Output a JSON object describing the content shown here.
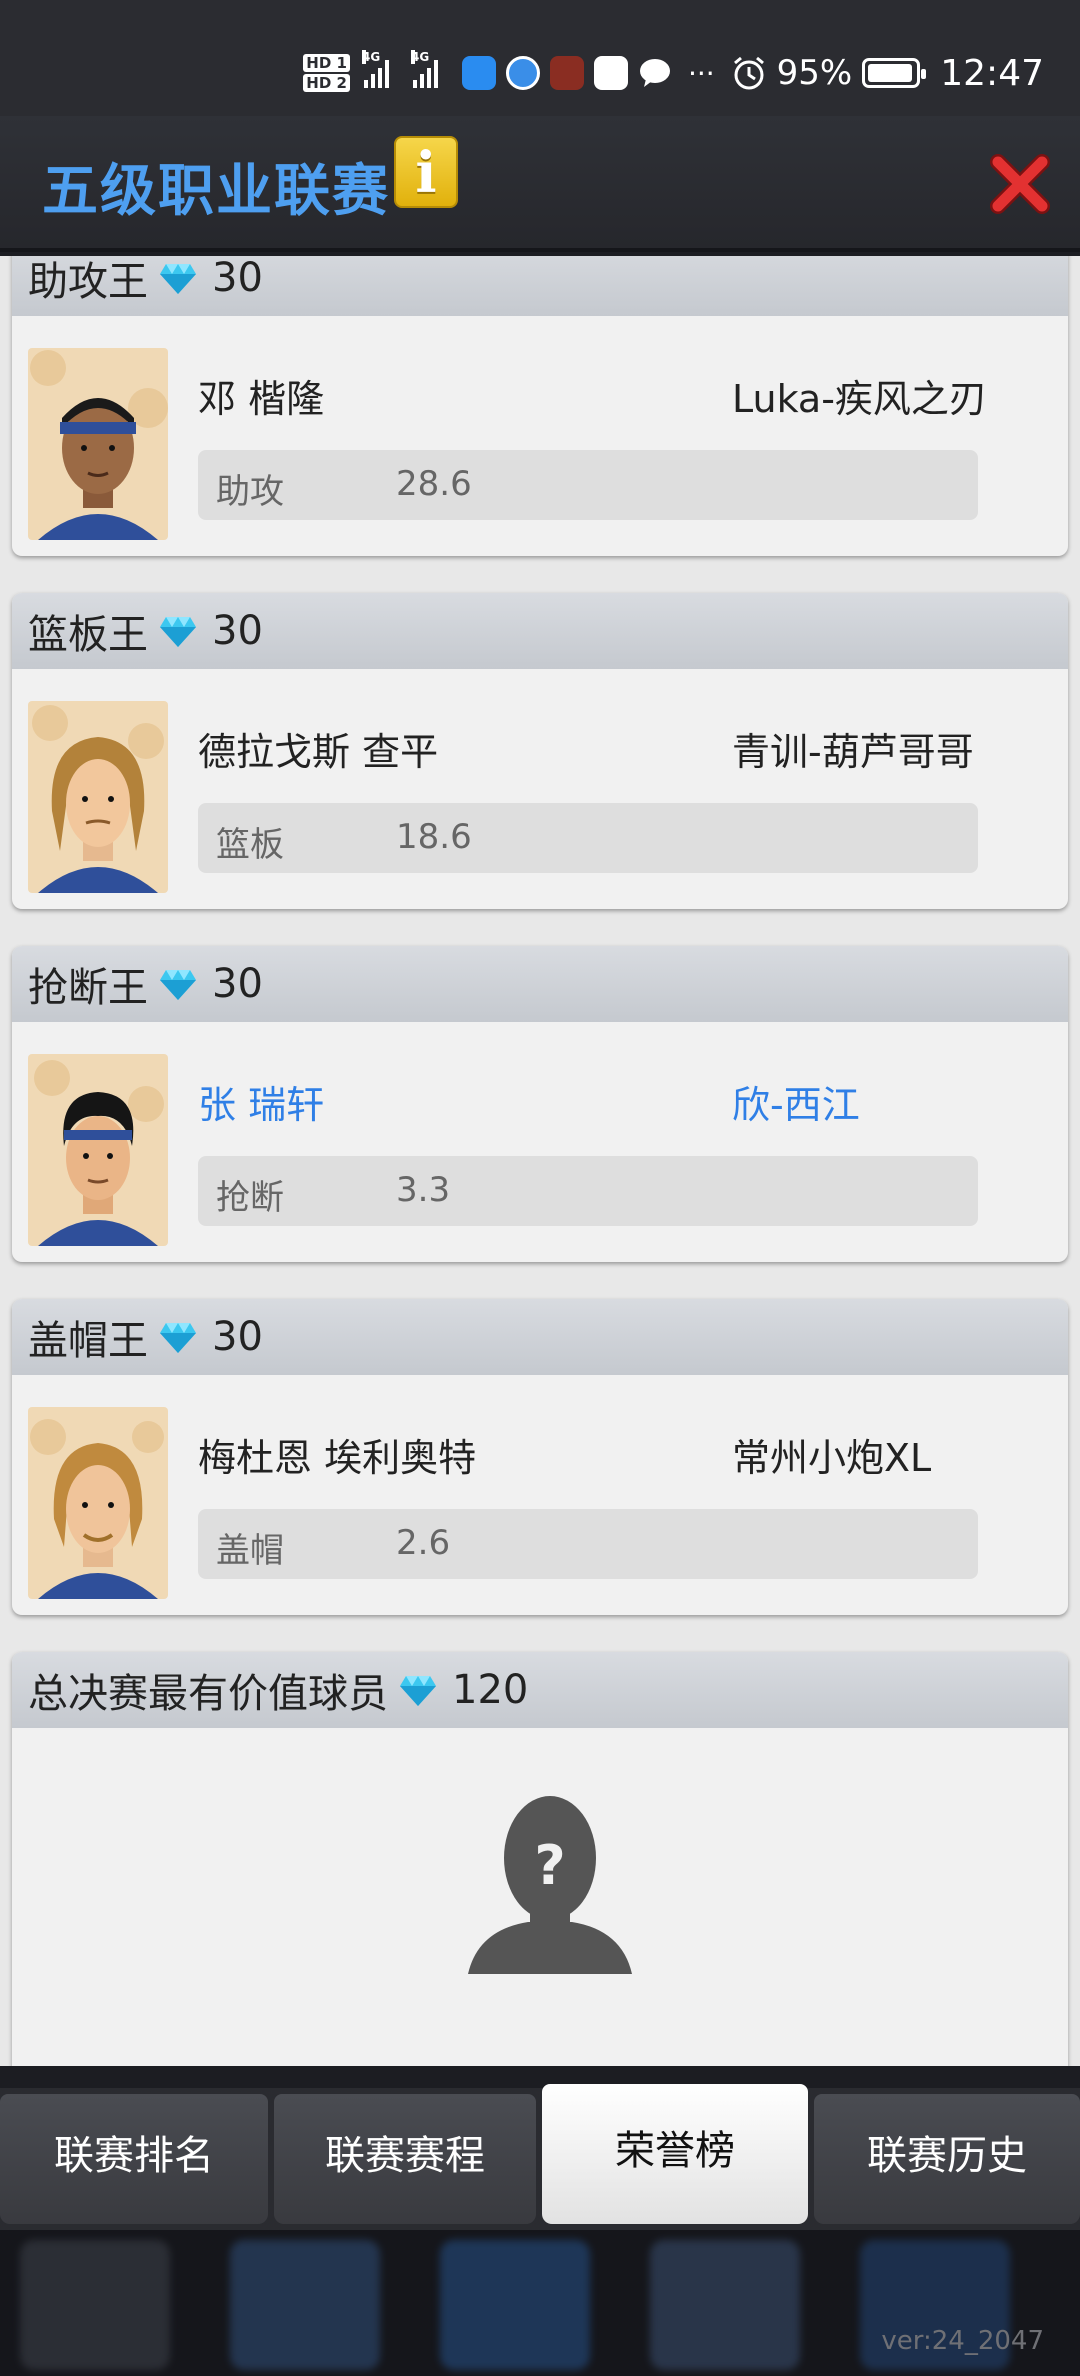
{
  "status_bar": {
    "network_1": "HD 1",
    "network_2": "HD 2",
    "signal_1": "4G",
    "signal_2": "4G",
    "battery_pct": "95%",
    "battery_level": 0.95,
    "time": "12:47"
  },
  "header": {
    "title": "五级职业联赛",
    "info_label": "i"
  },
  "awards": [
    {
      "title": "助攻王",
      "reward": "30",
      "player": "邓 楷隆",
      "team": "Luka-疾风之刃",
      "stat_label": "助攻",
      "stat_value": "28.6",
      "highlight": false
    },
    {
      "title": "篮板王",
      "reward": "30",
      "player": "德拉戈斯 查平",
      "team": "青训-葫芦哥哥",
      "stat_label": "篮板",
      "stat_value": "18.6",
      "highlight": false
    },
    {
      "title": "抢断王",
      "reward": "30",
      "player": "张 瑞轩",
      "team": "欣-西江",
      "stat_label": "抢断",
      "stat_value": "3.3",
      "highlight": true
    },
    {
      "title": "盖帽王",
      "reward": "30",
      "player": "梅杜恩 埃利奥特",
      "team": "常州小炮XL",
      "stat_label": "盖帽",
      "stat_value": "2.6",
      "highlight": false
    }
  ],
  "mvp": {
    "title": "总决赛最有价值球员",
    "reward": "120",
    "icon": "unknown-player-icon"
  },
  "tabs": [
    {
      "label": "联赛排名",
      "active": false
    },
    {
      "label": "联赛赛程",
      "active": false
    },
    {
      "label": "荣誉榜",
      "active": true
    },
    {
      "label": "联赛历史",
      "active": false
    }
  ],
  "footer": {
    "version": "ver:24_2047"
  },
  "colors": {
    "title_blue": "#4e9ff0",
    "highlight_blue": "#2f7fe6",
    "gem_cyan": "#3cc8f0",
    "close_red": "#d92a2a"
  }
}
